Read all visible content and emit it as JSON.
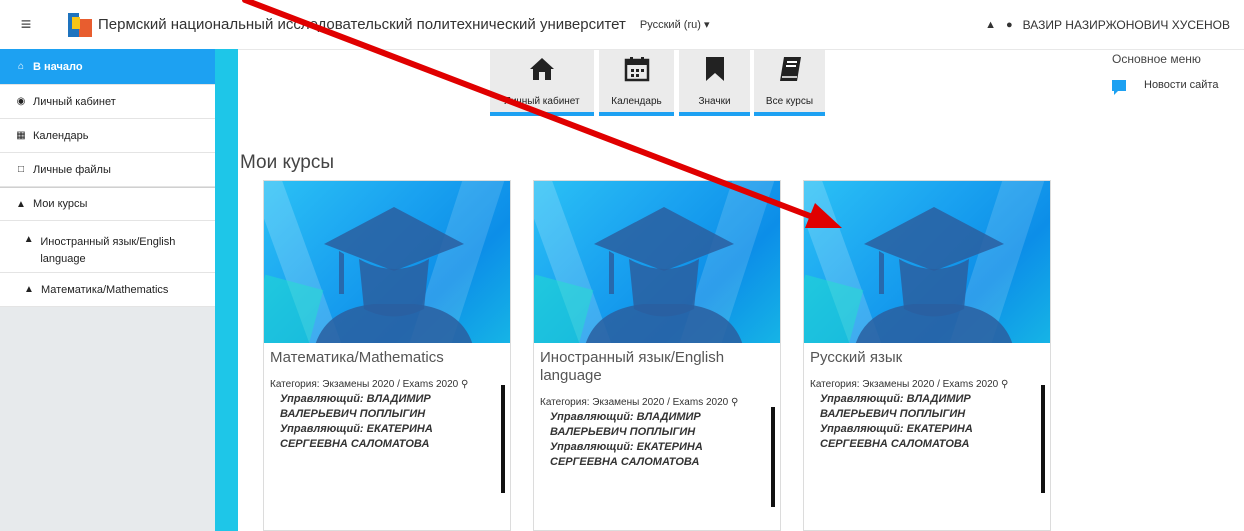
{
  "header": {
    "site_name": "Пермский национальный исследовательский политехнический университет",
    "language": "Русский (ru) ▾",
    "username": "ВАЗИР НАЗИРЖОНОВИЧ ХУСЕНОВ"
  },
  "sidebar": {
    "items": [
      {
        "label": "В начало",
        "icon": "home-icon",
        "active": true
      },
      {
        "label": "Личный кабинет",
        "icon": "dashboard-icon"
      },
      {
        "label": "Календарь",
        "icon": "calendar-icon"
      },
      {
        "label": "Личные файлы",
        "icon": "file-icon"
      },
      {
        "label": "Мои курсы",
        "icon": "graduation-cap-icon"
      },
      {
        "label": "Иностранный язык/English language",
        "icon": "graduation-cap-icon"
      },
      {
        "label": "Математика/Mathematics",
        "icon": "graduation-cap-icon"
      }
    ]
  },
  "quick_links": [
    {
      "label": "Личный кабинет",
      "icon": "home-icon"
    },
    {
      "label": "Календарь",
      "icon": "calendar-icon"
    },
    {
      "label": "Значки",
      "icon": "bookmark-icon"
    },
    {
      "label": "Все курсы",
      "icon": "book-icon"
    }
  ],
  "right_block": {
    "title": "Основное меню",
    "news_label": "Новости сайта"
  },
  "page_title": "Мои курсы",
  "courses": [
    {
      "name": "Математика/Mathematics",
      "category": "Категория: Экзамены 2020 / Exams 2020",
      "teachers": [
        "Управляющий: ВЛАДИМИР",
        "ВАЛЕРЬЕВИЧ ПОПЛЫГИН",
        "Управляющий: ЕКАТЕРИНА",
        "СЕРГЕЕВНА САЛОМАТОВА"
      ]
    },
    {
      "name": "Иностранный язык/English language",
      "category": "Категория: Экзамены 2020 / Exams 2020",
      "teachers": [
        "Управляющий: ВЛАДИМИР",
        "ВАЛЕРЬЕВИЧ ПОПЛЫГИН",
        "Управляющий: ЕКАТЕРИНА",
        "СЕРГЕЕВНА САЛОМАТОВА"
      ]
    },
    {
      "name": "Русский язык",
      "category": "Категория: Экзамены 2020 / Exams 2020",
      "teachers": [
        "Управляющий: ВЛАДИМИР",
        "ВАЛЕРЬЕВИЧ ПОПЛЫГИН",
        "Управляющий: ЕКАТЕРИНА",
        "СЕРГЕЕВНА САЛОМАТОВА"
      ]
    }
  ],
  "colors": {
    "accent": "#1da1f2",
    "strip": "#1ec6e8",
    "annotation_arrow": "#e00000"
  }
}
